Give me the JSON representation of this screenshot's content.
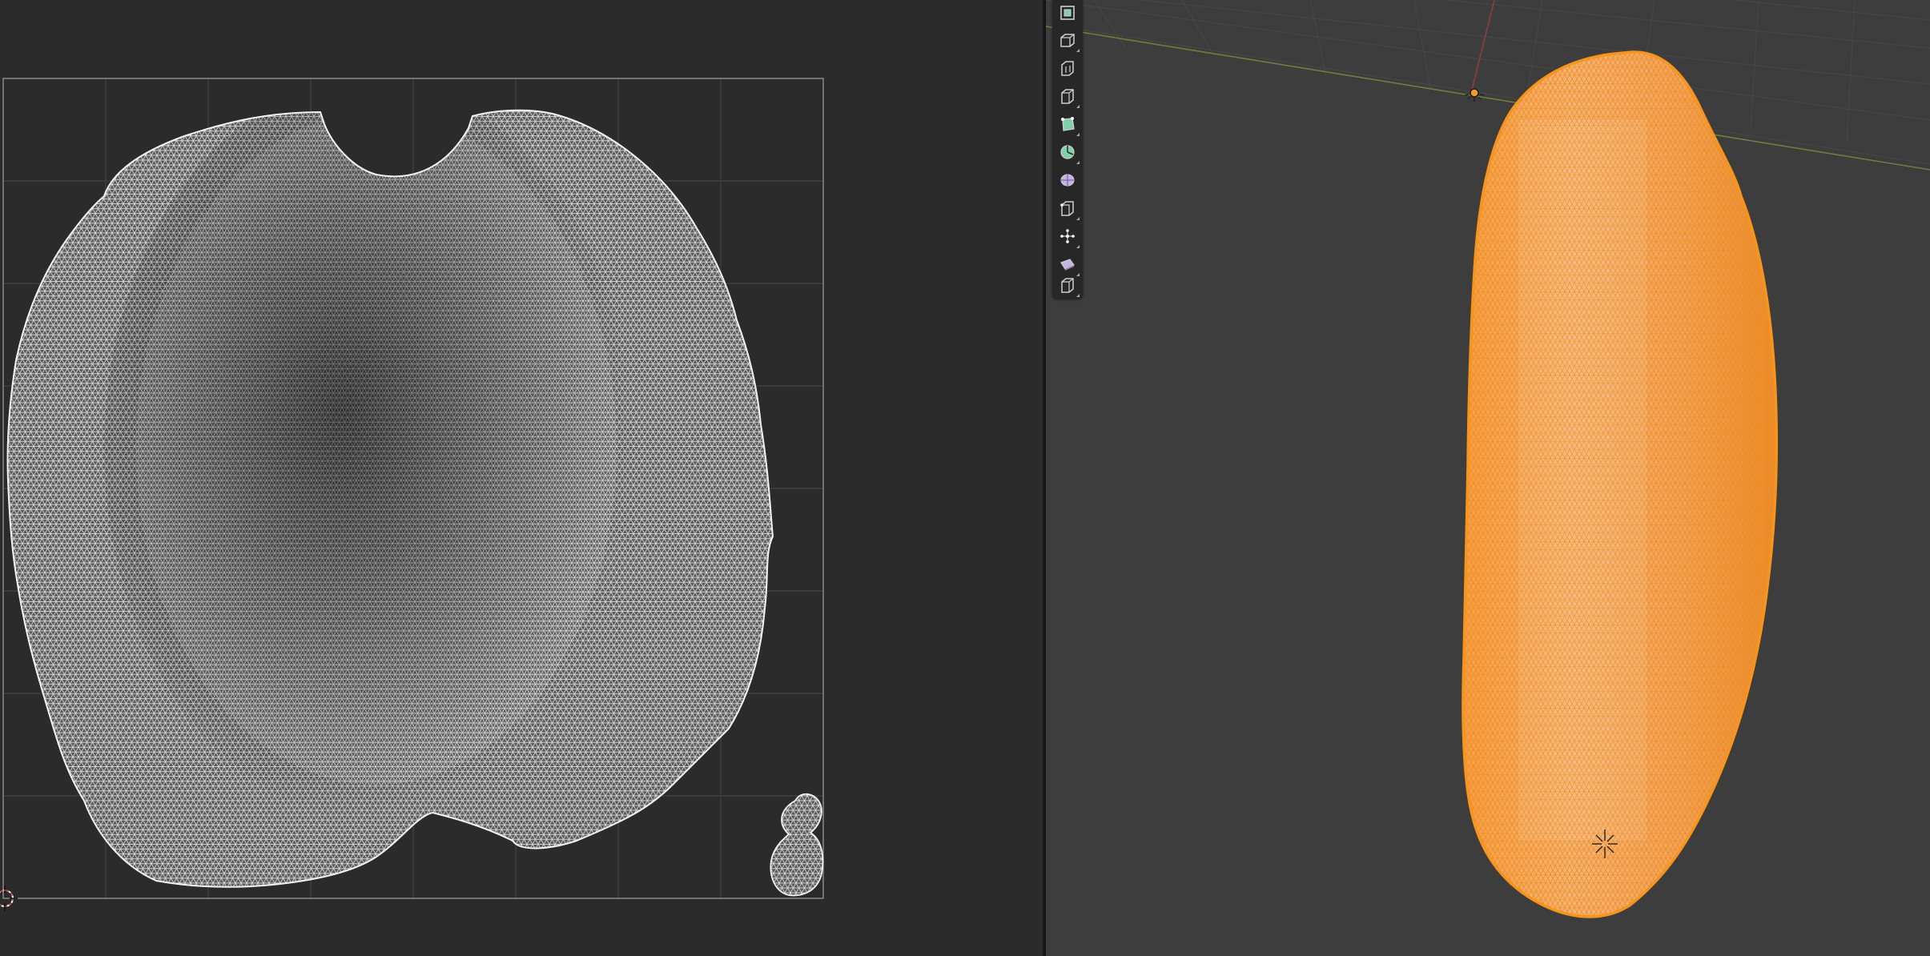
{
  "window": {
    "editors": [
      "uv-editor",
      "3d-viewport"
    ]
  },
  "theme": {
    "uv_background": "#2b2b2b",
    "uv_grid": "#3e3e3e",
    "uv_bounds": "#8a8a8a",
    "uv_island_fill": "#595959",
    "uv_wire": "#e8e8e8",
    "viewport_background": "#3d3d3d",
    "mesh_fill": "#f0a450",
    "mesh_wire": "#f7941d",
    "axis_x": "#8c3f3f",
    "axis_y": "#6d7e3d"
  },
  "uv_editor": {
    "islands": [
      "main-island",
      "small-island"
    ],
    "cursor_icon": "2d-cursor-icon"
  },
  "viewport": {
    "object": "selected-mesh",
    "object_origin_icon": "object-origin-icon",
    "cursor_icon": "3d-cursor-icon"
  },
  "toolbar": {
    "tools": [
      {
        "icon": "select-box-icon",
        "active": false
      },
      {
        "icon": "extrude-region-icon",
        "active": false
      },
      {
        "icon": "inset-faces-icon",
        "active": false
      },
      {
        "icon": "bevel-icon",
        "active": false
      },
      {
        "icon": "loop-cut-icon",
        "active": false
      },
      {
        "icon": "knife-icon",
        "active": false
      },
      {
        "icon": "poly-build-icon",
        "active": false
      },
      {
        "icon": "spin-icon",
        "active": false
      },
      {
        "icon": "smooth-vertices-icon",
        "active": false
      },
      {
        "icon": "edge-slide-icon",
        "active": false
      },
      {
        "icon": "shrink-fatten-icon",
        "active": false
      }
    ]
  }
}
